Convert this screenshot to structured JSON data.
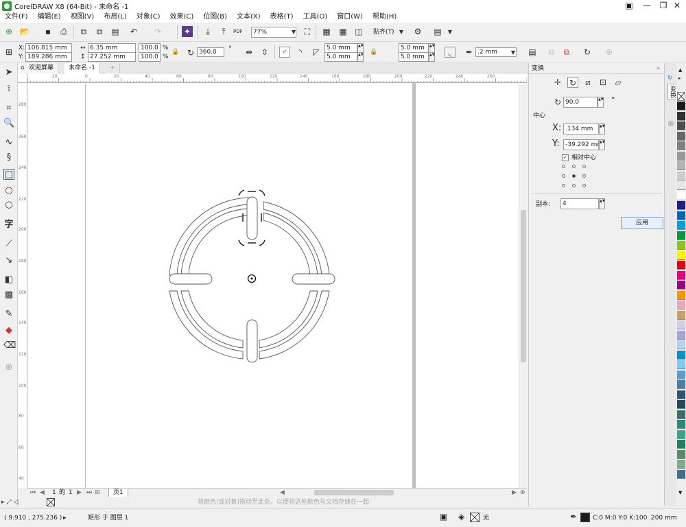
{
  "app": {
    "title": "CorelDRAW X8 (64-Bit) - 未命名 -1"
  },
  "menu": [
    "文件(F)",
    "编辑(E)",
    "视图(V)",
    "布局(L)",
    "对象(C)",
    "效果(C)",
    "位图(B)",
    "文本(X)",
    "表格(T)",
    "工具(O)",
    "窗口(W)",
    "帮助(H)"
  ],
  "standard_toolbar": {
    "zoom": "77%",
    "snap_label": "贴齐(T)",
    "pdf_label": "PDF"
  },
  "property_bar": {
    "x": "106.815 mm",
    "y": "189.286 mm",
    "width": "6.35 mm",
    "height": "27.252 mm",
    "scale_x": "100.0",
    "scale_y": "100.0",
    "percent": "%",
    "rotation": "360.0",
    "corner_1": "5.0 mm",
    "corner_2": "5.0 mm",
    "corner_3": "5.0 mm",
    "corner_4": "5.0 mm",
    "outline_width": ".2 mm"
  },
  "tabs": {
    "welcome": "欢迎屏幕",
    "document": "未命名 -1"
  },
  "ruler": {
    "h_ticks": [
      "20",
      "0",
      "20",
      "40",
      "60",
      "80",
      "100",
      "120",
      "140",
      "160",
      "180",
      "200",
      "220",
      "240",
      "260"
    ],
    "v_ticks": [
      "280",
      "260",
      "240",
      "220",
      "200",
      "180",
      "160",
      "140",
      "120",
      "100",
      "80",
      "60",
      "40",
      "20"
    ]
  },
  "page_nav": {
    "current": "1",
    "of": "的",
    "total": "1",
    "page_tab": "页1"
  },
  "hint_text": "将颜色(或对象)拖动至此处，以便将这些颜色与文档存储在一起",
  "docker": {
    "title": "变换",
    "strip_label": "变换",
    "rotation": "90.0",
    "degree_symbol": "°",
    "center_label": "中心",
    "x_label": "X:",
    "x_value": ".134 mm",
    "y_label": "Y:",
    "y_value": "-39.292 mm",
    "relative_center": "相对中心",
    "copies_label": "副本:",
    "copies_value": "4",
    "apply": "应用"
  },
  "status": {
    "coords": "( 9.910 , 275.236 )",
    "selection": "矩形 于 图层 1",
    "fill": "无",
    "outline": "C:0 M:0 Y:0 K:100  .200 mm"
  },
  "palette_colors": [
    "#1a1a1a",
    "#333333",
    "#4d4d4d",
    "#666666",
    "#808080",
    "#999999",
    "#b3b3b3",
    "#cccccc",
    "#e6e6e6",
    "#ffffff",
    "#1d2088",
    "#0068b7",
    "#00a0e9",
    "#009944",
    "#8fc31f",
    "#fff100",
    "#e60012",
    "#e4007f",
    "#920783",
    "#f39800",
    "#eea6b7",
    "#c9a063",
    "#d3cce6",
    "#a6a3d6",
    "#b7d2ee",
    "#0092c7",
    "#80c7f1",
    "#5b9bd5",
    "#4a7ea8",
    "#2d5574",
    "#22475e",
    "#3b6b6b",
    "#2a8a7a",
    "#3aa58a",
    "#1f7f5f",
    "#5a8a6a",
    "#7faa8a",
    "#3f6f8f"
  ]
}
